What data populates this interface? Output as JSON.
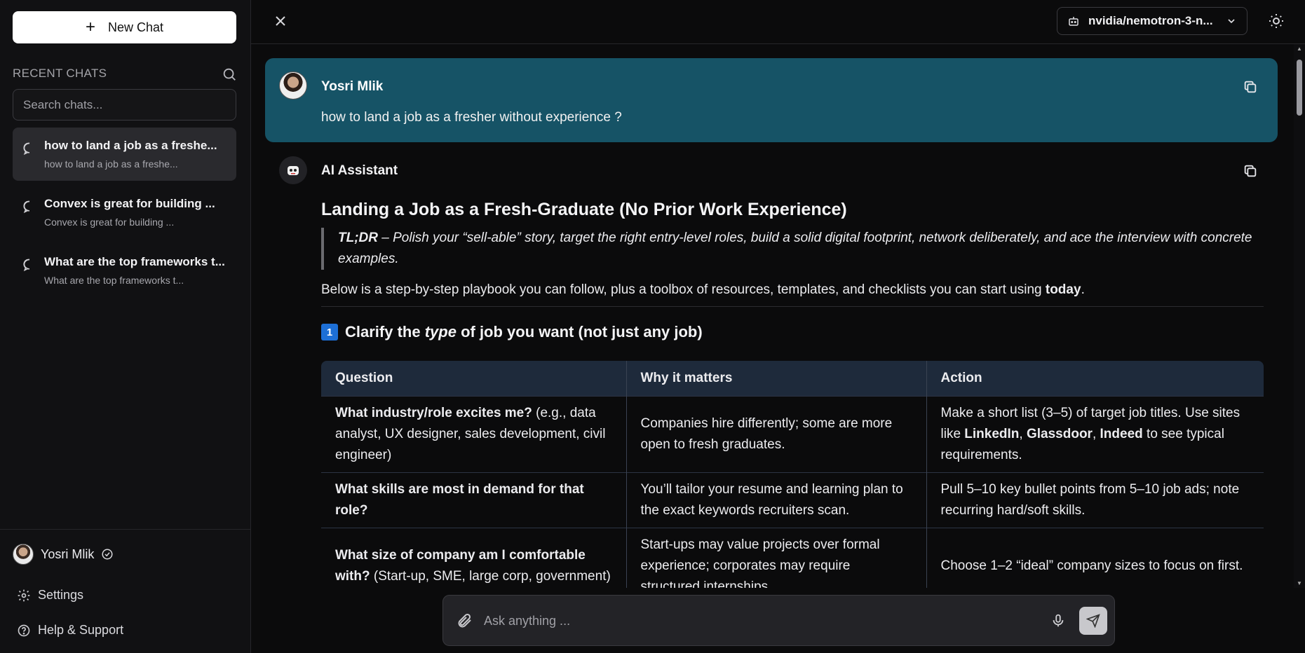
{
  "sidebar": {
    "new_chat_label": "New Chat",
    "recent_label": "RECENT CHATS",
    "search_placeholder": "Search chats...",
    "chats": [
      {
        "title": "how to land a job as a freshe...",
        "preview": "how to land a job as a freshe..."
      },
      {
        "title": "Convex is great for building ...",
        "preview": "Convex is great for building ..."
      },
      {
        "title": "What are the top frameworks t...",
        "preview": "What are the top frameworks t..."
      }
    ],
    "user_name": "Yosri Mlik",
    "settings_label": "Settings",
    "help_label": "Help & Support"
  },
  "topbar": {
    "model_name": "nvidia/nemotron-3-n..."
  },
  "conversation": {
    "user_name": "Yosri Mlik",
    "user_message": "how to land a job as a fresher without experience ?",
    "assistant_name": "AI Assistant",
    "heading": "Landing a Job as a Fresh-Graduate (No Prior Work Experience)",
    "tldr_label": "TL;DR",
    "tldr_text": " – Polish your “sell-able” story, target the right entry-level roles, build a solid digital footprint, network deliberately, and ace the interview with concrete examples.",
    "intro_text": "Below is a step-by-step playbook you can follow, plus a toolbox of resources, templates, and checklists you can start using ",
    "intro_bold": "today",
    "intro_end": ".",
    "section_number": "1",
    "section_title_pre": "Clarify the ",
    "section_title_em": "type",
    "section_title_post": " of job you want (not just any job)",
    "table": {
      "headers": [
        "Question",
        "Why it matters",
        "Action"
      ],
      "rows": [
        {
          "q_bold": "What industry/role excites me?",
          "q_rest": " (e.g., data analyst, UX designer, sales development, civil engineer)",
          "why": "Companies hire differently; some are more open to fresh graduates.",
          "action_pre": "Make a short list (3–5) of target job titles. Use sites like ",
          "action_b1": "LinkedIn",
          "action_sep1": ", ",
          "action_b2": "Glassdoor",
          "action_sep2": ", ",
          "action_b3": "Indeed",
          "action_post": " to see typical requirements."
        },
        {
          "q_bold": "What skills are most in demand for that role?",
          "q_rest": "",
          "why": "You’ll tailor your resume and learning plan to the exact keywords recruiters scan.",
          "action": "Pull 5–10 key bullet points from 5–10 job ads; note recurring hard/soft skills."
        },
        {
          "q_bold": "What size of company am I comfortable with?",
          "q_rest": " (Start-up, SME, large corp, government)",
          "why": "Start-ups may value projects over formal experience; corporates may require structured internships.",
          "action": "Choose 1–2 “ideal” company sizes to focus on first."
        }
      ]
    }
  },
  "composer": {
    "placeholder": "Ask anything ..."
  },
  "colors": {
    "user_bubble": "#165366",
    "table_header": "#1e2a3b",
    "badge": "#1d6fd6"
  }
}
